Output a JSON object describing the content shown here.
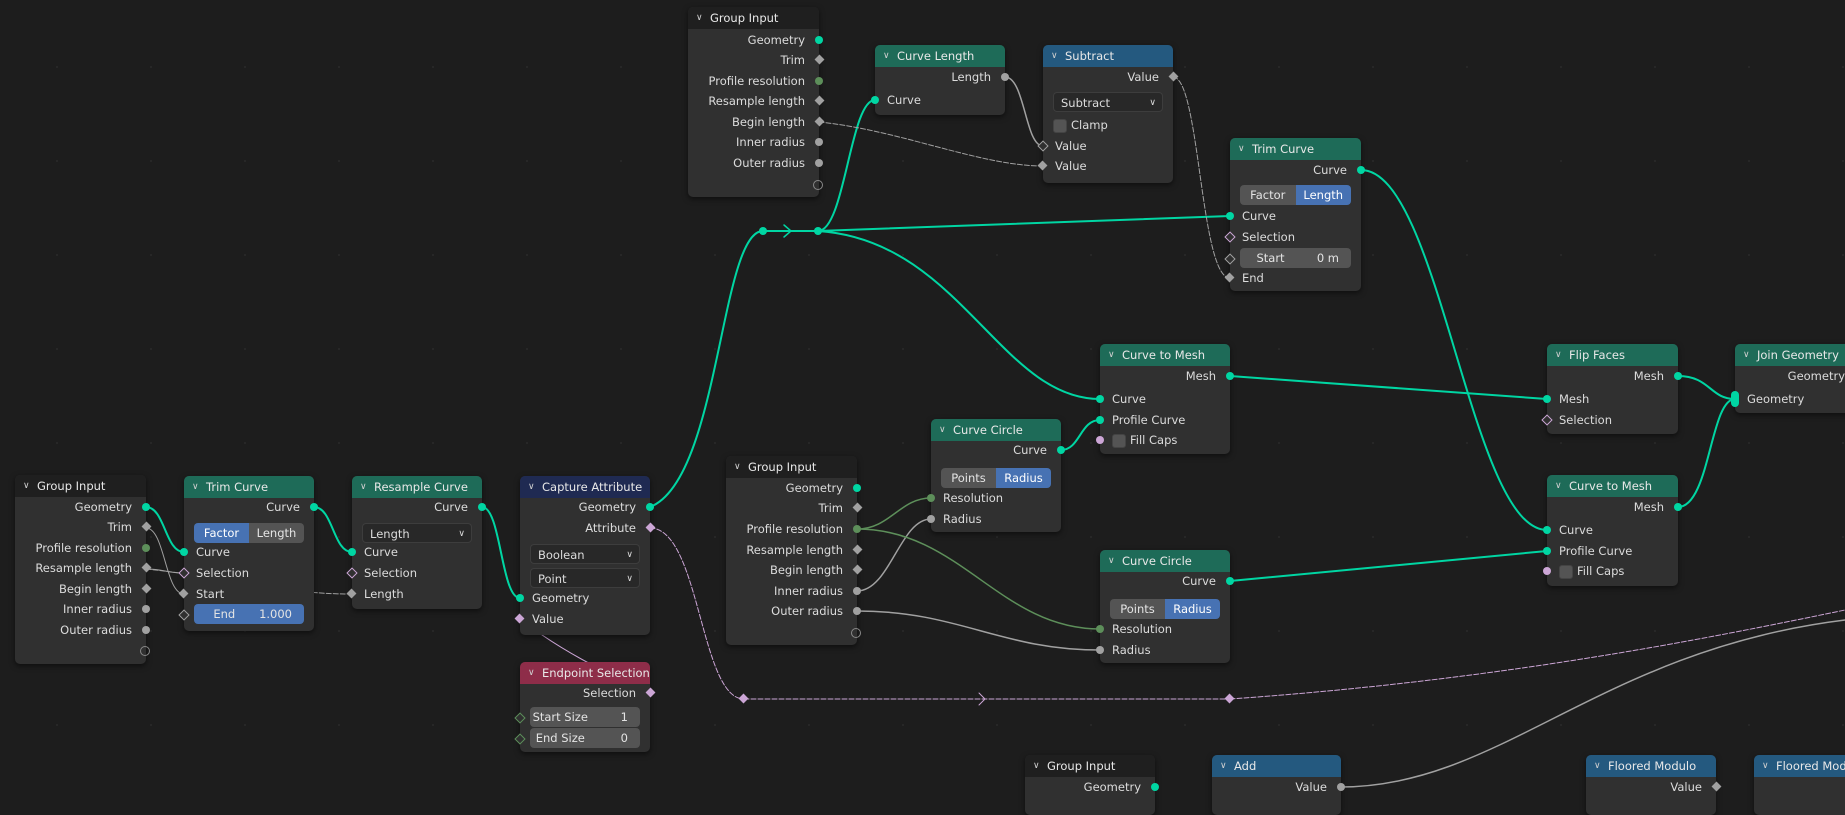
{
  "editor": "Geometry Node Editor",
  "colors": {
    "geometry_socket": "#00d6a3",
    "float_socket": "#a1a1a1",
    "int_socket": "#5d8f5a",
    "bool_socket": "#cca6d6",
    "geometry_header": "#1e6b58",
    "math_header": "#24597f",
    "attribute_header": "#1f2a52",
    "selection_header": "#8e2d49",
    "active_toggle": "#4772b3",
    "background": "#1d1d1d"
  },
  "group_input_sockets": [
    "Geometry",
    "Trim",
    "Profile resolution",
    "Resample length",
    "Begin length",
    "Inner radius",
    "Outer radius"
  ],
  "nodes": {
    "group_input_left": {
      "title": "Group Input"
    },
    "trim_curve_1": {
      "title": "Trim Curve",
      "out_curve": "Curve",
      "mode": [
        "Factor",
        "Length"
      ],
      "mode_active": "Factor",
      "in_curve": "Curve",
      "in_selection": "Selection",
      "in_start": "Start",
      "end_label": "End",
      "end_value": "1.000"
    },
    "resample_curve": {
      "title": "Resample Curve",
      "out_curve": "Curve",
      "mode": "Length",
      "in_curve": "Curve",
      "in_selection": "Selection",
      "in_length": "Length"
    },
    "capture_attribute": {
      "title": "Capture Attribute",
      "out_geometry": "Geometry",
      "out_attribute": "Attribute",
      "data_type": "Boolean",
      "domain": "Point",
      "in_geometry": "Geometry",
      "in_value": "Value"
    },
    "endpoint_selection": {
      "title": "Endpoint Selection",
      "out_selection": "Selection",
      "start_label": "Start Size",
      "start_value": "1",
      "end_label": "End Size",
      "end_value": "0"
    },
    "group_input_top": {
      "title": "Group Input"
    },
    "curve_length": {
      "title": "Curve Length",
      "out_length": "Length",
      "in_curve": "Curve"
    },
    "subtract": {
      "title": "Subtract",
      "out_value": "Value",
      "operation": "Subtract",
      "clamp_label": "Clamp",
      "in_value_a": "Value",
      "in_value_b": "Value"
    },
    "trim_curve_2": {
      "title": "Trim Curve",
      "out_curve": "Curve",
      "mode": [
        "Factor",
        "Length"
      ],
      "mode_active": "Length",
      "in_curve": "Curve",
      "in_selection": "Selection",
      "start_label": "Start",
      "start_value": "0 m",
      "in_end": "End"
    },
    "curve_to_mesh_1": {
      "title": "Curve to Mesh",
      "out_mesh": "Mesh",
      "in_curve": "Curve",
      "in_profile": "Profile Curve",
      "fill_caps": "Fill Caps"
    },
    "group_input_mid": {
      "title": "Group Input"
    },
    "curve_circle_1": {
      "title": "Curve Circle",
      "out_curve": "Curve",
      "mode": [
        "Points",
        "Radius"
      ],
      "mode_active": "Radius",
      "in_resolution": "Resolution",
      "in_radius": "Radius"
    },
    "curve_circle_2": {
      "title": "Curve Circle",
      "out_curve": "Curve",
      "mode": [
        "Points",
        "Radius"
      ],
      "mode_active": "Radius",
      "in_resolution": "Resolution",
      "in_radius": "Radius"
    },
    "flip_faces": {
      "title": "Flip Faces",
      "out_mesh": "Mesh",
      "in_mesh": "Mesh",
      "in_selection": "Selection"
    },
    "curve_to_mesh_2": {
      "title": "Curve to Mesh",
      "out_mesh": "Mesh",
      "in_curve": "Curve",
      "in_profile": "Profile Curve",
      "fill_caps": "Fill Caps"
    },
    "join_geometry": {
      "title": "Join Geometry",
      "out_geometry": "Geometry",
      "in_geometry": "Geometry"
    },
    "group_input_bottom": {
      "title": "Group Input",
      "out_geometry": "Geometry"
    },
    "add": {
      "title": "Add",
      "out_value": "Value"
    },
    "floored_modulo_1": {
      "title": "Floored Modulo",
      "out_value": "Value"
    },
    "floored_modulo_2": {
      "title": "Floored Modulo"
    }
  }
}
